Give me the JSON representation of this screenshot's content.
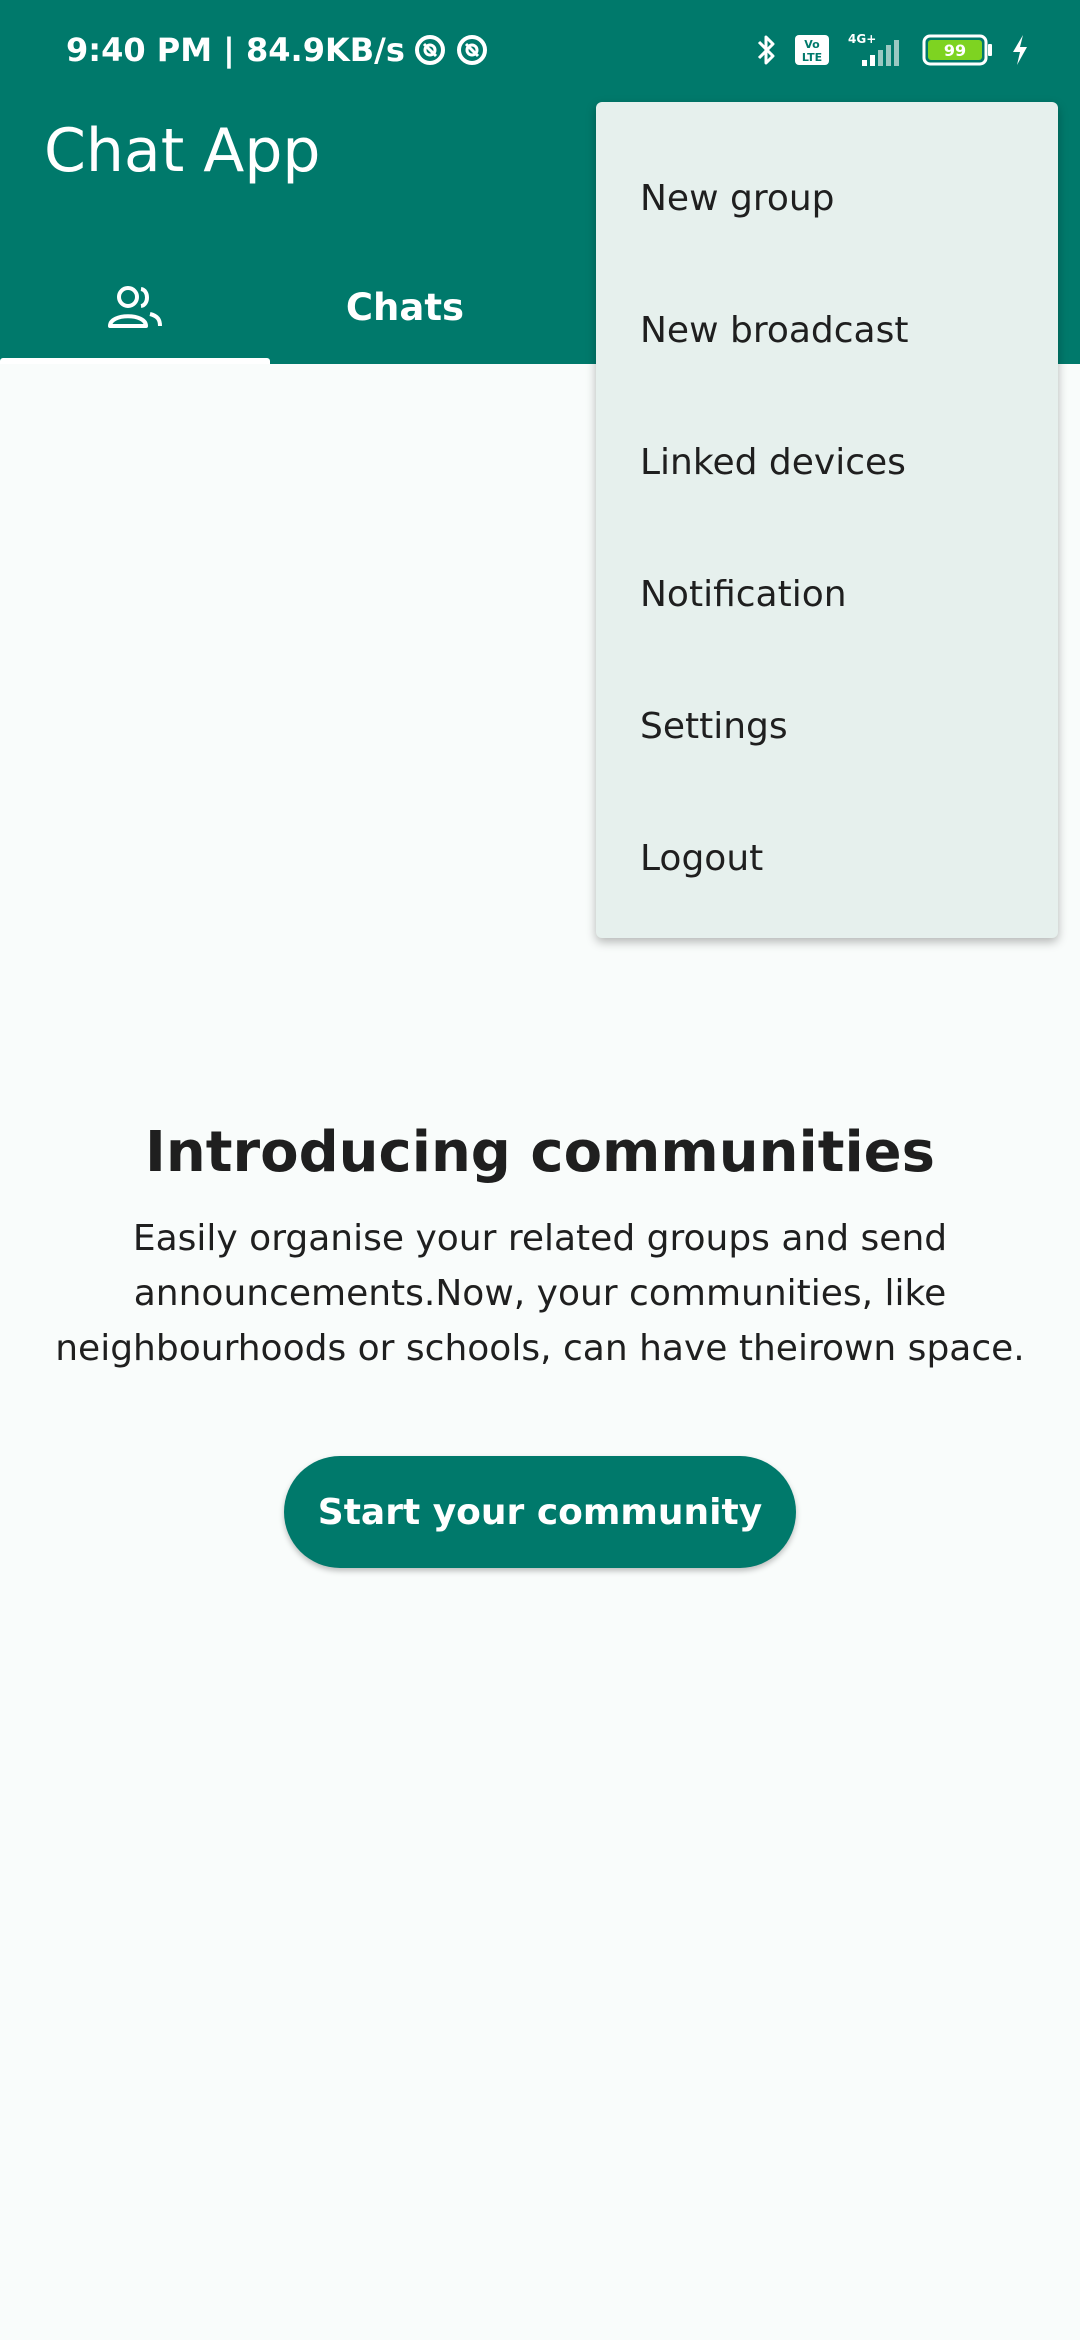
{
  "status_bar": {
    "time_speed": "9:40 PM | 84.9KB/s",
    "network": "4G+",
    "volte_top": "Vo",
    "volte_bottom": "LTE",
    "battery": "99"
  },
  "app": {
    "title": "Chat App"
  },
  "tabs": {
    "community_icon": "people-icon",
    "chats_label": "Chats"
  },
  "menu": {
    "items": [
      {
        "label": "New group"
      },
      {
        "label": "New broadcast"
      },
      {
        "label": "Linked devices"
      },
      {
        "label": "Notification"
      },
      {
        "label": "Settings"
      },
      {
        "label": "Logout"
      }
    ]
  },
  "main": {
    "headline": "Introducing communities",
    "description_line1": "Easily organise your related groups and send",
    "description_line2": "announcements.Now, your communities, like",
    "description_line3": "neighbourhoods or schools, can have theirown space.",
    "cta_label": "Start your community"
  },
  "colors": {
    "primary": "#00796b",
    "background": "#f9fcfb",
    "menu_bg": "#e6f0ed",
    "text": "#1f1f1f"
  }
}
